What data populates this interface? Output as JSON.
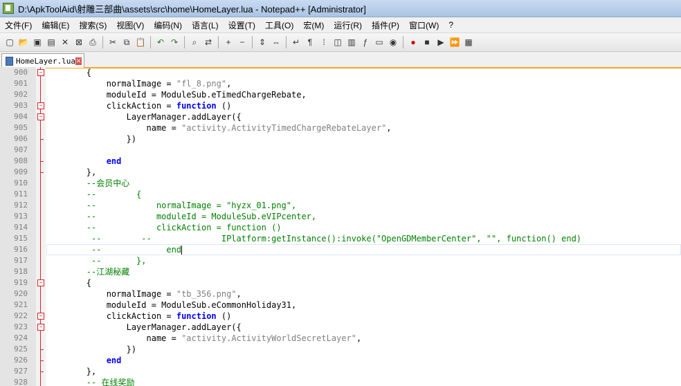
{
  "window": {
    "title": "D:\\ApkToolAid\\射雕三部曲\\assets\\src\\home\\HomeLayer.lua - Notepad++ [Administrator]"
  },
  "menu": [
    "文件(F)",
    "编辑(E)",
    "搜索(S)",
    "视图(V)",
    "编码(N)",
    "语言(L)",
    "设置(T)",
    "工具(O)",
    "宏(M)",
    "运行(R)",
    "插件(P)",
    "窗口(W)",
    "?"
  ],
  "toolbar": {
    "icons": [
      "new-file-icon",
      "open-file-icon",
      "save-icon",
      "save-all-icon",
      "close-icon",
      "close-all-icon",
      "print-icon",
      "sep",
      "cut-icon",
      "copy-icon",
      "paste-icon",
      "sep",
      "undo-icon",
      "redo-icon",
      "sep",
      "find-icon",
      "replace-icon",
      "sep",
      "zoom-in-icon",
      "zoom-out-icon",
      "sep",
      "sync-v-icon",
      "sync-h-icon",
      "sep",
      "wrap-icon",
      "show-all-chars-icon",
      "indent-guide-icon",
      "user-lang-icon",
      "doc-map-icon",
      "function-list-icon",
      "folder-icon",
      "monitor-icon",
      "sep",
      "record-macro-icon",
      "stop-macro-icon",
      "play-macro-icon",
      "run-macro-multiple-icon",
      "save-macro-icon"
    ]
  },
  "tab": {
    "label": "HomeLayer.lua"
  },
  "editor": {
    "lines": [
      {
        "n": "900",
        "fold": "box",
        "segs": [
          [
            "p",
            "        {"
          ]
        ]
      },
      {
        "n": "901",
        "fold": "line",
        "segs": [
          [
            "p",
            "            normalImage = "
          ],
          [
            "s",
            "\"fl_8.png\""
          ],
          [
            "p",
            ","
          ]
        ]
      },
      {
        "n": "902",
        "fold": "line",
        "segs": [
          [
            "p",
            "            moduleId = ModuleSub.eTimedChargeRebate,"
          ]
        ]
      },
      {
        "n": "903",
        "fold": "box",
        "segs": [
          [
            "p",
            "            clickAction = "
          ],
          [
            "k",
            "function"
          ],
          [
            "p",
            " ()"
          ]
        ]
      },
      {
        "n": "904",
        "fold": "box",
        "segs": [
          [
            "p",
            "                LayerManager.addLayer({"
          ]
        ]
      },
      {
        "n": "905",
        "fold": "line",
        "segs": [
          [
            "p",
            "                    name = "
          ],
          [
            "s",
            "\"activity.ActivityTimedChargeRebateLayer\""
          ],
          [
            "p",
            ","
          ]
        ]
      },
      {
        "n": "906",
        "fold": "end",
        "segs": [
          [
            "p",
            "                })"
          ]
        ]
      },
      {
        "n": "907",
        "fold": "line",
        "segs": [
          [
            "p",
            ""
          ]
        ]
      },
      {
        "n": "908",
        "fold": "end",
        "segs": [
          [
            "p",
            "            "
          ],
          [
            "k",
            "end"
          ]
        ]
      },
      {
        "n": "909",
        "fold": "end",
        "segs": [
          [
            "p",
            "        },"
          ]
        ]
      },
      {
        "n": "910",
        "fold": "line",
        "segs": [
          [
            "c",
            "        --会员中心"
          ]
        ]
      },
      {
        "n": "911",
        "fold": "line",
        "segs": [
          [
            "c",
            "        --        {"
          ]
        ]
      },
      {
        "n": "912",
        "fold": "line",
        "segs": [
          [
            "c",
            "        --            normalImage = \"hyzx_01.png\","
          ]
        ]
      },
      {
        "n": "913",
        "fold": "line",
        "segs": [
          [
            "c",
            "        --            moduleId = ModuleSub.eVIPcenter,"
          ]
        ]
      },
      {
        "n": "914",
        "fold": "line",
        "segs": [
          [
            "c",
            "        --            clickAction = function ()"
          ]
        ]
      },
      {
        "n": "915",
        "fold": "line",
        "segs": [
          [
            "c",
            "         --        --              IPlatform:getInstance():invoke(\"OpenGDMemberCenter\", \"\", function() end)"
          ]
        ]
      },
      {
        "n": "916",
        "fold": "line",
        "current": true,
        "segs": [
          [
            "c",
            "         --             end"
          ]
        ]
      },
      {
        "n": "917",
        "fold": "line",
        "segs": [
          [
            "c",
            "         --       },"
          ]
        ]
      },
      {
        "n": "918",
        "fold": "line",
        "segs": [
          [
            "c",
            "        --江湖秘藏"
          ]
        ]
      },
      {
        "n": "919",
        "fold": "box",
        "segs": [
          [
            "p",
            "        {"
          ]
        ]
      },
      {
        "n": "920",
        "fold": "line",
        "segs": [
          [
            "p",
            "            normalImage = "
          ],
          [
            "s",
            "\"tb_356.png\""
          ],
          [
            "p",
            ","
          ]
        ]
      },
      {
        "n": "921",
        "fold": "line",
        "segs": [
          [
            "p",
            "            moduleId = ModuleSub.eCommonHoliday31,"
          ]
        ]
      },
      {
        "n": "922",
        "fold": "box",
        "segs": [
          [
            "p",
            "            clickAction = "
          ],
          [
            "k",
            "function"
          ],
          [
            "p",
            " ()"
          ]
        ]
      },
      {
        "n": "923",
        "fold": "box",
        "segs": [
          [
            "p",
            "                LayerManager.addLayer({"
          ]
        ]
      },
      {
        "n": "924",
        "fold": "line",
        "segs": [
          [
            "p",
            "                    name = "
          ],
          [
            "s",
            "\"activity.ActivityWorldSecretLayer\""
          ],
          [
            "p",
            ","
          ]
        ]
      },
      {
        "n": "925",
        "fold": "end",
        "segs": [
          [
            "p",
            "                })"
          ]
        ]
      },
      {
        "n": "926",
        "fold": "end",
        "segs": [
          [
            "p",
            "            "
          ],
          [
            "k",
            "end"
          ]
        ]
      },
      {
        "n": "927",
        "fold": "end",
        "segs": [
          [
            "p",
            "        },"
          ]
        ]
      },
      {
        "n": "928",
        "fold": "line",
        "segs": [
          [
            "c",
            "        -- 在线奖励"
          ]
        ]
      }
    ]
  }
}
